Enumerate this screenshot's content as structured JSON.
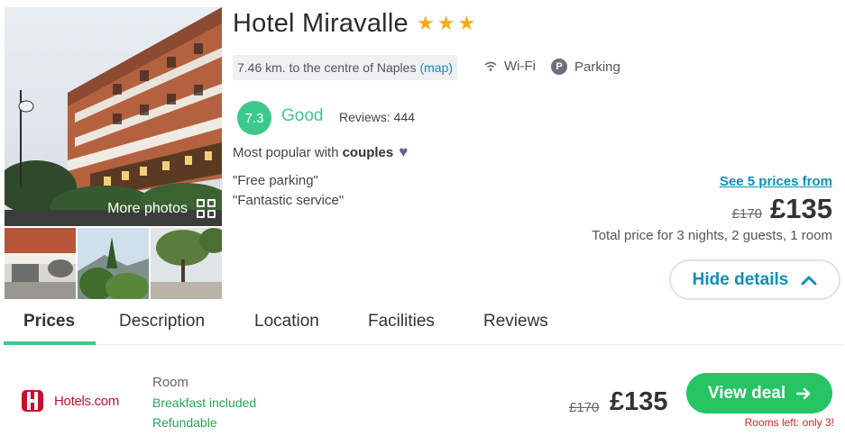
{
  "photos": {
    "more_photos_label": "More photos",
    "grid_icon": "grid-icon"
  },
  "hotel": {
    "name": "Hotel Miravalle",
    "stars": 3,
    "star_color": "#f6ab1b",
    "distance_text": "7.46 km. to the centre of Naples",
    "map_link": "(map)",
    "amenities": [
      {
        "label": "Wi-Fi",
        "icon": "wifi-icon"
      },
      {
        "label": "Parking",
        "icon": "parking-icon",
        "icon_letter": "P"
      }
    ]
  },
  "rating": {
    "score": "7.3",
    "word": "Good",
    "reviews": "Reviews: 444",
    "color": "#3ec98c"
  },
  "popular": {
    "prefix": "Most popular with",
    "group": "couples",
    "icon": "heart-icon"
  },
  "quotes": [
    "\"Free parking\"",
    "\"Fantastic service\""
  ],
  "pricing": {
    "see_prices": "See 5 prices from",
    "old_price": "£170",
    "new_price": "£135",
    "total_text": "Total price for 3 nights, 2 guests, 1 room"
  },
  "hide_details": {
    "label": "Hide details",
    "icon": "chevron-up-icon"
  },
  "tabs": [
    {
      "label": "Prices",
      "active": true
    },
    {
      "label": "Description"
    },
    {
      "label": "Location"
    },
    {
      "label": "Facilities"
    },
    {
      "label": "Reviews"
    }
  ],
  "deal": {
    "provider": "Hotels.com",
    "provider_color": "#c8102e",
    "room": "Room",
    "perks": [
      "Breakfast included",
      "Refundable"
    ],
    "old_price": "£170",
    "new_price": "£135",
    "cta": "View deal",
    "cta_color": "#27c464",
    "rooms_left": "Rooms left: only 3!"
  }
}
